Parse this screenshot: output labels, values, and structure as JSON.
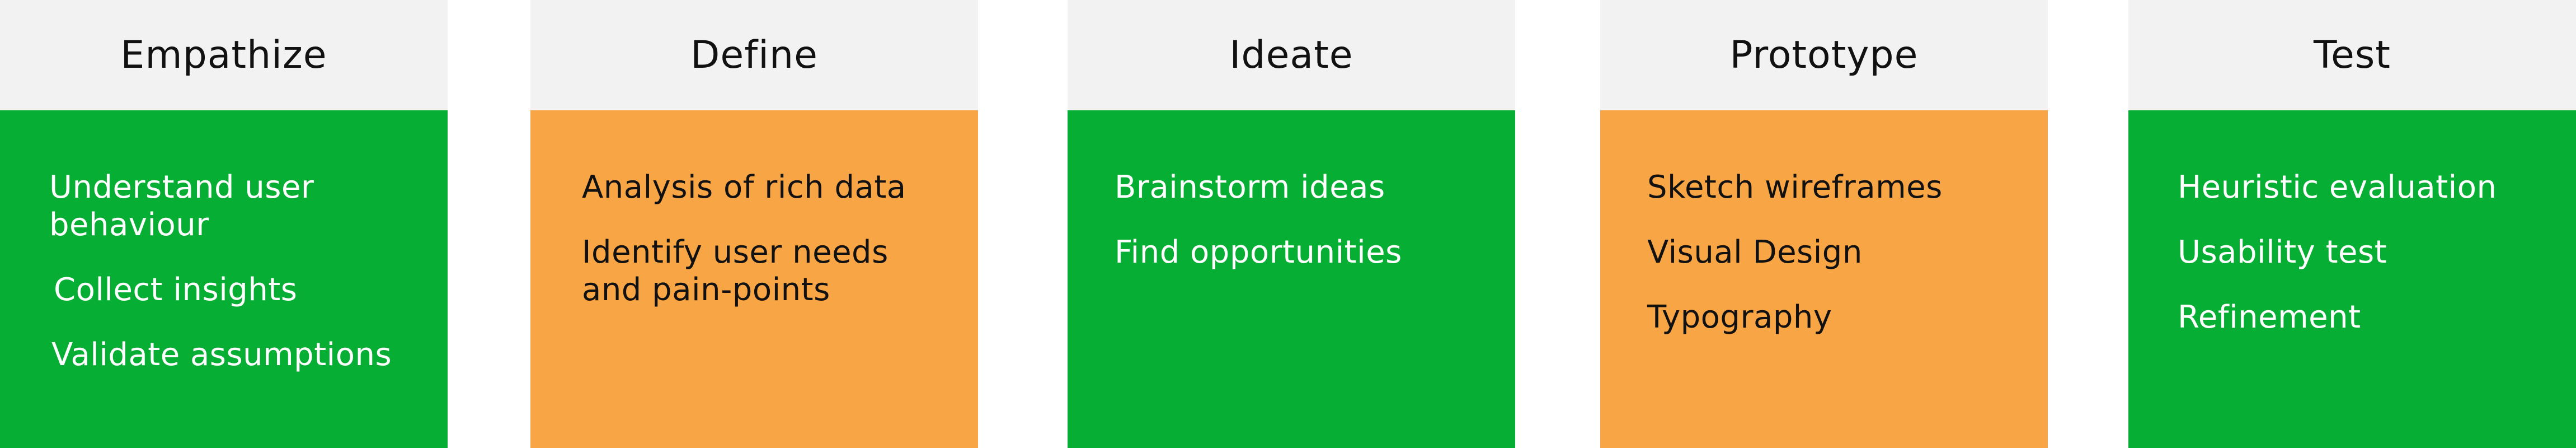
{
  "stages": [
    {
      "title": "Empathize",
      "color": "#06ae33",
      "items": [
        "Understand user behaviour",
        "Collect insights",
        "Validate assumptions"
      ]
    },
    {
      "title": "Define",
      "color": "#f8a545",
      "items": [
        "Analysis of rich data",
        "Identify user needs and pain-points"
      ]
    },
    {
      "title": "Ideate",
      "color": "#06ae33",
      "items": [
        "Brainstorm ideas",
        "Find opportunities"
      ]
    },
    {
      "title": "Prototype",
      "color": "#f8a545",
      "items": [
        "Sketch wireframes",
        "Visual Design",
        "Typography"
      ]
    },
    {
      "title": "Test",
      "color": "#06ae33",
      "items": [
        "Heuristic evaluation",
        "Usability test",
        "Refinement"
      ]
    }
  ]
}
